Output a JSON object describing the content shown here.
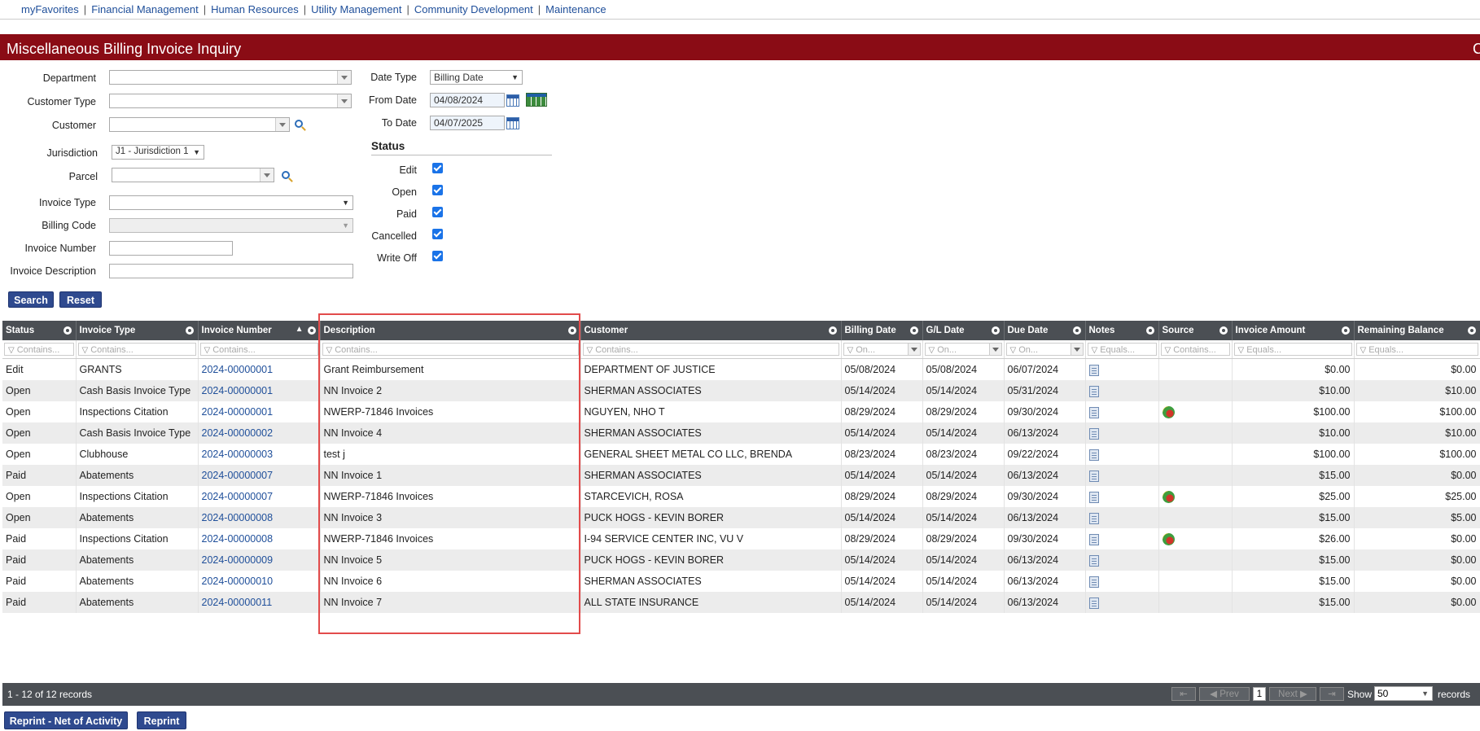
{
  "nav": {
    "items": [
      "myFavorites",
      "Financial Management",
      "Human Resources",
      "Utility Management",
      "Community Development",
      "Maintenance"
    ],
    "separator": "|"
  },
  "page_title": "Miscellaneous Billing Invoice Inquiry",
  "title_edge_glyph": "C",
  "form": {
    "department_label": "Department",
    "customer_type_label": "Customer Type",
    "customer_label": "Customer",
    "jurisdiction_label": "Jurisdiction",
    "jurisdiction_value": "J1 - Jurisdiction 1",
    "parcel_label": "Parcel",
    "invoice_type_label": "Invoice Type",
    "billing_code_label": "Billing Code",
    "invoice_number_label": "Invoice Number",
    "invoice_description_label": "Invoice Description",
    "date_type_label": "Date Type",
    "date_type_value": "Billing Date",
    "from_date_label": "From Date",
    "from_date_value": "04/08/2024",
    "to_date_label": "To Date",
    "to_date_value": "04/07/2025",
    "status_heading": "Status",
    "status_edit": "Edit",
    "status_open": "Open",
    "status_paid": "Paid",
    "status_cancelled": "Cancelled",
    "status_writeoff": "Write Off",
    "search_label": "Search",
    "reset_label": "Reset"
  },
  "grid": {
    "columns": [
      "Status",
      "Invoice Type",
      "Invoice Number",
      "Description",
      "Customer",
      "Billing Date",
      "G/L Date",
      "Due Date",
      "Notes",
      "Source",
      "Invoice Amount",
      "Remaining Balance"
    ],
    "filters": [
      "Contains...",
      "Contains...",
      "Contains...",
      "Contains...",
      "Contains...",
      "On...",
      "On...",
      "On...",
      "Equals...",
      "Contains...",
      "Equals...",
      "Equals..."
    ],
    "rows": [
      {
        "status": "Edit",
        "type": "GRANTS",
        "number": "2024-00000001",
        "desc": "Grant Reimbursement",
        "customer": "DEPARTMENT OF JUSTICE",
        "billing": "05/08/2024",
        "gl": "05/08/2024",
        "due": "06/07/2024",
        "source": false,
        "amount": "$0.00",
        "balance": "$0.00"
      },
      {
        "status": "Open",
        "type": "Cash Basis Invoice Type",
        "number": "2024-00000001",
        "desc": "NN Invoice 2",
        "customer": "SHERMAN ASSOCIATES",
        "billing": "05/14/2024",
        "gl": "05/14/2024",
        "due": "05/31/2024",
        "source": false,
        "amount": "$10.00",
        "balance": "$10.00"
      },
      {
        "status": "Open",
        "type": "Inspections Citation",
        "number": "2024-00000001",
        "desc": "NWERP-71846 Invoices",
        "customer": "NGUYEN, NHO T",
        "billing": "08/29/2024",
        "gl": "08/29/2024",
        "due": "09/30/2024",
        "source": true,
        "amount": "$100.00",
        "balance": "$100.00"
      },
      {
        "status": "Open",
        "type": "Cash Basis Invoice Type",
        "number": "2024-00000002",
        "desc": "NN Invoice 4",
        "customer": "SHERMAN ASSOCIATES",
        "billing": "05/14/2024",
        "gl": "05/14/2024",
        "due": "06/13/2024",
        "source": false,
        "amount": "$10.00",
        "balance": "$10.00"
      },
      {
        "status": "Open",
        "type": "Clubhouse",
        "number": "2024-00000003",
        "desc": "test j",
        "customer": "GENERAL SHEET METAL CO LLC, BRENDA",
        "billing": "08/23/2024",
        "gl": "08/23/2024",
        "due": "09/22/2024",
        "source": false,
        "amount": "$100.00",
        "balance": "$100.00"
      },
      {
        "status": "Paid",
        "type": "Abatements",
        "number": "2024-00000007",
        "desc": "NN Invoice 1",
        "customer": "SHERMAN ASSOCIATES",
        "billing": "05/14/2024",
        "gl": "05/14/2024",
        "due": "06/13/2024",
        "source": false,
        "amount": "$15.00",
        "balance": "$0.00"
      },
      {
        "status": "Open",
        "type": "Inspections Citation",
        "number": "2024-00000007",
        "desc": "NWERP-71846 Invoices",
        "customer": "STARCEVICH, ROSA",
        "billing": "08/29/2024",
        "gl": "08/29/2024",
        "due": "09/30/2024",
        "source": true,
        "amount": "$25.00",
        "balance": "$25.00"
      },
      {
        "status": "Open",
        "type": "Abatements",
        "number": "2024-00000008",
        "desc": "NN Invoice 3",
        "customer": "PUCK HOGS - KEVIN BORER",
        "billing": "05/14/2024",
        "gl": "05/14/2024",
        "due": "06/13/2024",
        "source": false,
        "amount": "$15.00",
        "balance": "$5.00"
      },
      {
        "status": "Paid",
        "type": "Inspections Citation",
        "number": "2024-00000008",
        "desc": "NWERP-71846 Invoices",
        "customer": "I-94 SERVICE CENTER INC, VU V",
        "billing": "08/29/2024",
        "gl": "08/29/2024",
        "due": "09/30/2024",
        "source": true,
        "amount": "$26.00",
        "balance": "$0.00"
      },
      {
        "status": "Paid",
        "type": "Abatements",
        "number": "2024-00000009",
        "desc": "NN Invoice 5",
        "customer": "PUCK HOGS - KEVIN BORER",
        "billing": "05/14/2024",
        "gl": "05/14/2024",
        "due": "06/13/2024",
        "source": false,
        "amount": "$15.00",
        "balance": "$0.00"
      },
      {
        "status": "Paid",
        "type": "Abatements",
        "number": "2024-00000010",
        "desc": "NN Invoice 6",
        "customer": "SHERMAN ASSOCIATES",
        "billing": "05/14/2024",
        "gl": "05/14/2024",
        "due": "06/13/2024",
        "source": false,
        "amount": "$15.00",
        "balance": "$0.00"
      },
      {
        "status": "Paid",
        "type": "Abatements",
        "number": "2024-00000011",
        "desc": "NN Invoice 7",
        "customer": "ALL STATE INSURANCE",
        "billing": "05/14/2024",
        "gl": "05/14/2024",
        "due": "06/13/2024",
        "source": false,
        "amount": "$15.00",
        "balance": "$0.00"
      }
    ]
  },
  "footer": {
    "record_count": "1 - 12 of 12 records",
    "prev_label": "Prev",
    "next_label": "Next",
    "current_page": "1",
    "show_label": "Show",
    "page_size": "50",
    "records_label": "records",
    "first_glyph": "⇤",
    "last_glyph": "⇥",
    "prev_glyph": "◀",
    "next_glyph": "▶"
  },
  "actions": {
    "reprint_net_label": "Reprint - Net of Activity",
    "reprint_label": "Reprint"
  },
  "colors": {
    "title_bar": "#8a0c15",
    "grid_header": "#4b4f54",
    "button": "#2f4a8f",
    "highlight": "#e24b4b"
  }
}
